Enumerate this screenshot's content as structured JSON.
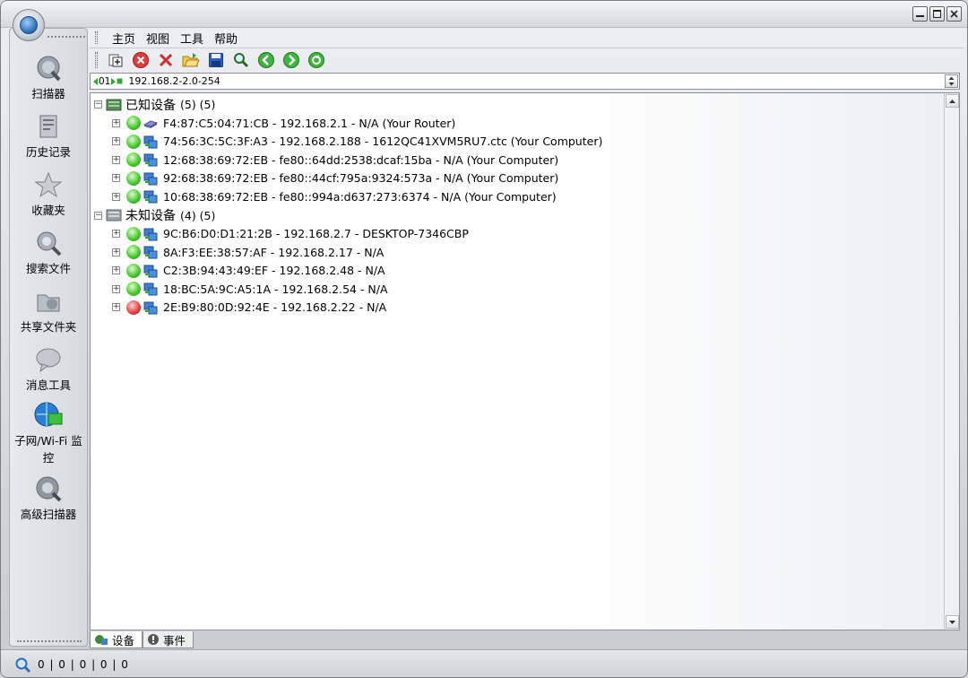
{
  "menu": [
    "主页",
    "视图",
    "工具",
    "帮助"
  ],
  "toolbar": [
    {
      "name": "add-icon"
    },
    {
      "name": "stop-icon"
    },
    {
      "name": "delete-icon"
    },
    {
      "name": "open-folder-icon"
    },
    {
      "name": "save-icon"
    },
    {
      "name": "find-icon"
    },
    {
      "name": "back-icon"
    },
    {
      "name": "forward-icon"
    },
    {
      "name": "refresh-icon"
    }
  ],
  "address": {
    "nav": "01",
    "value": "192.168.2-2.0-254"
  },
  "sidebar": [
    {
      "label": "扫描器",
      "icon": "scanner-icon"
    },
    {
      "label": "历史记录",
      "icon": "history-icon"
    },
    {
      "label": "收藏夹",
      "icon": "favorites-icon"
    },
    {
      "label": "搜索文件",
      "icon": "search-files-icon"
    },
    {
      "label": "共享文件夹",
      "icon": "shared-folder-icon"
    },
    {
      "label": "消息工具",
      "icon": "message-icon"
    },
    {
      "label": "子网/Wi-Fi 监控",
      "icon": "subnet-monitor-icon"
    },
    {
      "label": "高级扫描器",
      "icon": "advanced-scanner-icon"
    }
  ],
  "groups": [
    {
      "label": "已知设备",
      "count": "(5) (5)",
      "devices": [
        {
          "text": "F4:87:C5:04:71:CB - 192.168.2.1 - N/A (Your Router)",
          "status": "online",
          "type": "router"
        },
        {
          "text": "74:56:3C:5C:3F:A3 - 192.168.2.188 - 1612QC41XVM5RU7.ctc (Your Computer)",
          "status": "online",
          "type": "computer"
        },
        {
          "text": "12:68:38:69:72:EB - fe80::64dd:2538:dcaf:15ba - N/A (Your Computer)",
          "status": "online",
          "type": "computer"
        },
        {
          "text": "92:68:38:69:72:EB - fe80::44cf:795a:9324:573a - N/A (Your Computer)",
          "status": "online",
          "type": "computer"
        },
        {
          "text": "10:68:38:69:72:EB - fe80::994a:d637:273:6374 - N/A (Your Computer)",
          "status": "online",
          "type": "computer"
        }
      ]
    },
    {
      "label": "未知设备",
      "count": "(4) (5)",
      "devices": [
        {
          "text": "9C:B6:D0:D1:21:2B - 192.168.2.7 - DESKTOP-7346CBP",
          "status": "online",
          "type": "computer"
        },
        {
          "text": "8A:F3:EE:38:57:AF - 192.168.2.17 - N/A",
          "status": "online",
          "type": "computer"
        },
        {
          "text": "C2:3B:94:43:49:EF - 192.168.2.48 - N/A",
          "status": "online",
          "type": "computer"
        },
        {
          "text": "18:BC:5A:9C:A5:1A - 192.168.2.54 - N/A",
          "status": "online",
          "type": "computer"
        },
        {
          "text": "2E:B9:80:0D:92:4E - 192.168.2.22 - N/A",
          "status": "offline",
          "type": "computer"
        }
      ]
    }
  ],
  "tabs": [
    {
      "label": "设备",
      "icon": "devices-icon",
      "active": true
    },
    {
      "label": "事件",
      "icon": "events-icon",
      "active": false
    }
  ],
  "status": {
    "value": "0 | 0 | 0 | 0 | 0"
  },
  "colors": {
    "online": "#43c22b",
    "offline": "#e23c3c",
    "accent": "#2e6fb8"
  }
}
